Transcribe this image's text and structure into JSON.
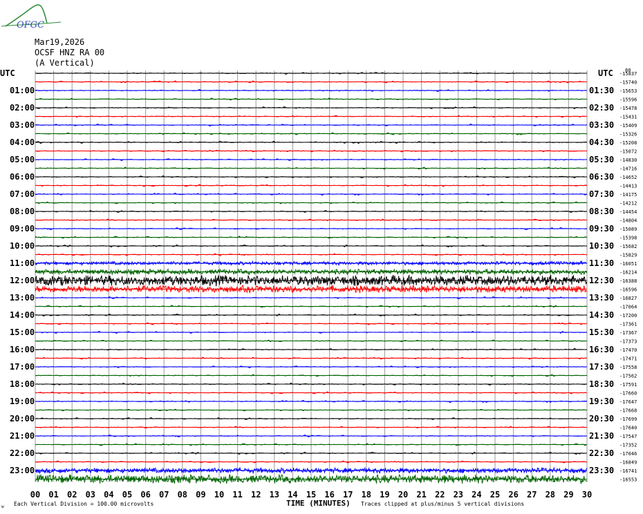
{
  "header": {
    "logo_text": "OFGC",
    "date": "Mar19,2026",
    "station": "OCSF HNZ RA 00",
    "component": "(A Vertical)"
  },
  "axis": {
    "left_unit": "UTC",
    "right_unit": "UTC",
    "right_top_label": "80",
    "left_labels": [
      "01:00",
      "02:00",
      "03:00",
      "04:00",
      "05:00",
      "06:00",
      "07:00",
      "08:00",
      "09:00",
      "10:00",
      "11:00",
      "12:00",
      "13:00",
      "14:00",
      "15:00",
      "16:00",
      "17:00",
      "18:00",
      "19:00",
      "20:00",
      "21:00",
      "22:00",
      "23:00"
    ],
    "right_labels": [
      "01:30",
      "02:30",
      "03:30",
      "04:30",
      "05:30",
      "06:30",
      "07:30",
      "08:30",
      "09:30",
      "10:30",
      "11:30",
      "12:30",
      "13:30",
      "14:30",
      "15:30",
      "16:30",
      "17:30",
      "18:30",
      "19:30",
      "20:30",
      "21:30",
      "22:30",
      "23:30"
    ],
    "offsets": [
      "-15837",
      "-15740",
      "-15653",
      "-15596",
      "-15478",
      "-15431",
      "-15409",
      "-15326",
      "-15208",
      "-15072",
      "-14830",
      "-14716",
      "-14652",
      "-14413",
      "-14175",
      "-14212",
      "-14454",
      "-14804",
      "-15089",
      "-15398",
      "-15682",
      "-15829",
      "-16051",
      "-16214",
      "-16388",
      "-16596",
      "-16827",
      "-17064",
      "-17200",
      "-17361",
      "-17367",
      "-17373",
      "-17470",
      "-17471",
      "-17558",
      "-17562",
      "-17591",
      "-17660",
      "-17647",
      "-17668",
      "-17699",
      "-17640",
      "-17547",
      "-17352",
      "-17046",
      "-16849",
      "-16741",
      "-16553"
    ],
    "x_ticks": [
      "00",
      "01",
      "02",
      "03",
      "04",
      "05",
      "06",
      "07",
      "08",
      "09",
      "10",
      "11",
      "12",
      "13",
      "14",
      "15",
      "16",
      "17",
      "18",
      "19",
      "20",
      "21",
      "22",
      "23",
      "24",
      "25",
      "26",
      "27",
      "28",
      "29",
      "30"
    ],
    "x_title": "TIME (MINUTES)"
  },
  "footer": {
    "scale_note": "Each Vertical Division =  100.00 microvolts",
    "clip_note": "Traces clipped at plus/minus 5 vertical divisions",
    "mark": "w"
  },
  "colors": {
    "trace_cycle": [
      "#000000",
      "#ff0000",
      "#0000ff",
      "#006400"
    ],
    "grid": "#999999",
    "text": "#000000"
  },
  "chart_data": {
    "type": "line",
    "title": "",
    "xlabel": "TIME (MINUTES)",
    "ylabel": "UTC",
    "xlim": [
      0,
      30
    ],
    "rows": 48,
    "row_minutes": 30,
    "series_activity": [
      1,
      1,
      1,
      1,
      1,
      1,
      1,
      1,
      1,
      1,
      1,
      1,
      1,
      1,
      1,
      1,
      1,
      1,
      1,
      1,
      1,
      1,
      2,
      3,
      6,
      4,
      1,
      1,
      1,
      1,
      1,
      1,
      1,
      1,
      1,
      1,
      1,
      1,
      1,
      1,
      1,
      1,
      1,
      1,
      1,
      1,
      3,
      5
    ]
  }
}
